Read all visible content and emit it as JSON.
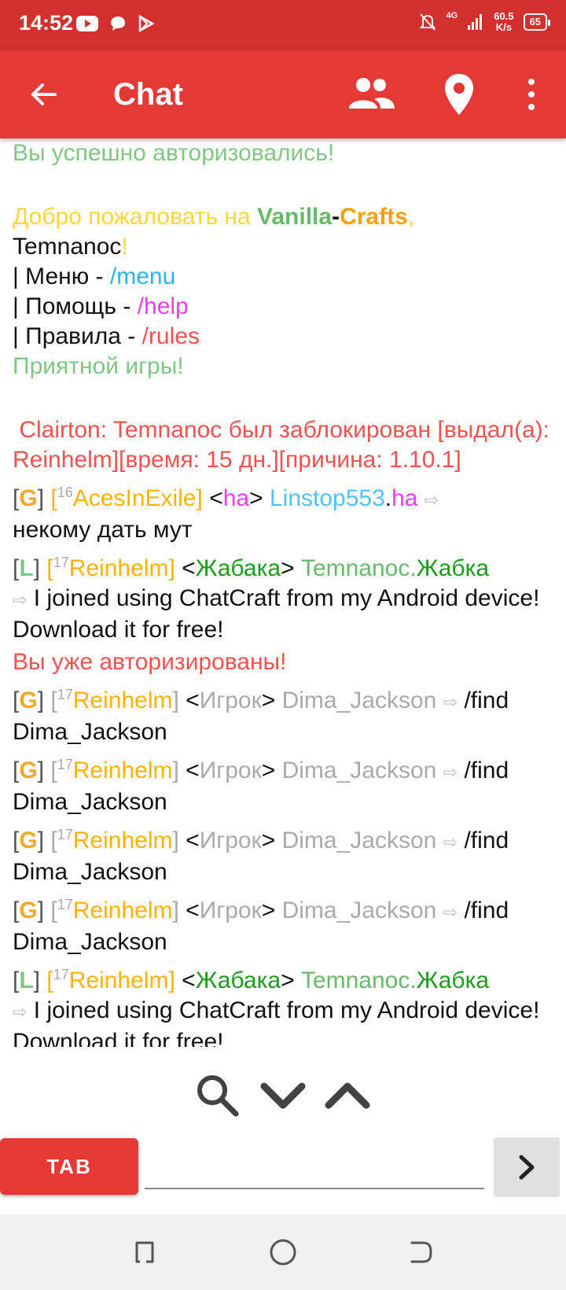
{
  "status": {
    "time": "14:52",
    "network": "4G",
    "speed_value": "60.5",
    "speed_unit": "K/s",
    "battery": "65"
  },
  "appbar": {
    "title": "Chat"
  },
  "colors": {
    "accent": "#e53935",
    "status_bar": "#d32f2f"
  },
  "chat": {
    "partial_top": "Вы успешно авторизовались!",
    "welcome": {
      "prefix": "Добро пожаловать на ",
      "vanilla": "Vanilla",
      "dash": "-",
      "crafts": "Crafts",
      "comma": ",",
      "player": "Temnanoc",
      "bang": "!",
      "menu_label": "| Меню - ",
      "menu_cmd": "/menu",
      "help_label": "| Помощь - ",
      "help_cmd": "/help",
      "rules_label": "| Правила - ",
      "rules_cmd": "/rules",
      "enjoy": "Приятной игры!"
    },
    "ban_notice": " Clairton: Temnanoc был заблокирован [выдал(а): Reinhelm][время: 15 дн.][причина: 1.10.1]",
    "already_authorized": "Вы уже авторизированы!",
    "messages": [
      {
        "bo": "[",
        "tag": "G",
        "bc": "]",
        "lo": "[",
        "lvl": "16",
        "name": "AcesInExile",
        "lc": "]",
        "ro": "<",
        "role": "ha",
        "rc": ">",
        "nick": "Linstop553",
        "dot": ".",
        "suffix": "ha",
        "arrow": "⇨",
        "text": "некому дать мут"
      },
      {
        "bo": "[",
        "tag": "L",
        "bc": "]",
        "lo": "[",
        "lvl": "17",
        "name": "Reinhelm",
        "lc": "]",
        "ro": "<",
        "role": "Жабака",
        "rc": ">",
        "nick": "Temnanoc",
        "dot": ".",
        "suffix": "Жабка",
        "arrow": "⇨",
        "text": "I joined using ChatCraft from my Android device! Download it for free!"
      },
      {
        "bo": "[",
        "tag": "G",
        "bc": "]",
        "lo": "[",
        "lvl": "17",
        "name": "Reinhelm",
        "lc": "]",
        "ro": "<",
        "role": "Игрок",
        "rc": ">",
        "nick": "Dima_Jackson",
        "arrow": "⇨",
        "text": "/find Dima_Jackson"
      },
      {
        "bo": "[",
        "tag": "G",
        "bc": "]",
        "lo": "[",
        "lvl": "17",
        "name": "Reinhelm",
        "lc": "]",
        "ro": "<",
        "role": "Игрок",
        "rc": ">",
        "nick": "Dima_Jackson",
        "arrow": "⇨",
        "text": "/find Dima_Jackson"
      },
      {
        "bo": "[",
        "tag": "G",
        "bc": "]",
        "lo": "[",
        "lvl": "17",
        "name": "Reinhelm",
        "lc": "]",
        "ro": "<",
        "role": "Игрок",
        "rc": ">",
        "nick": "Dima_Jackson",
        "arrow": "⇨",
        "text": "/find Dima_Jackson"
      },
      {
        "bo": "[",
        "tag": "G",
        "bc": "]",
        "lo": "[",
        "lvl": "17",
        "name": "Reinhelm",
        "lc": "]",
        "ro": "<",
        "role": "Игрок",
        "rc": ">",
        "nick": "Dima_Jackson",
        "arrow": "⇨",
        "text": "/find Dima_Jackson"
      },
      {
        "bo": "[",
        "tag": "L",
        "bc": "]",
        "lo": "[",
        "lvl": "17",
        "name": "Reinhelm",
        "lc": "]",
        "ro": "<",
        "role": "Жабака",
        "rc": ">",
        "nick": "Temnanoc",
        "dot": ".",
        "suffix": "Жабка",
        "arrow": "⇨",
        "text": "I joined using ChatCraft from my Android device! Download it for free!"
      }
    ]
  },
  "input": {
    "tab_label": "TAB",
    "placeholder": ""
  }
}
